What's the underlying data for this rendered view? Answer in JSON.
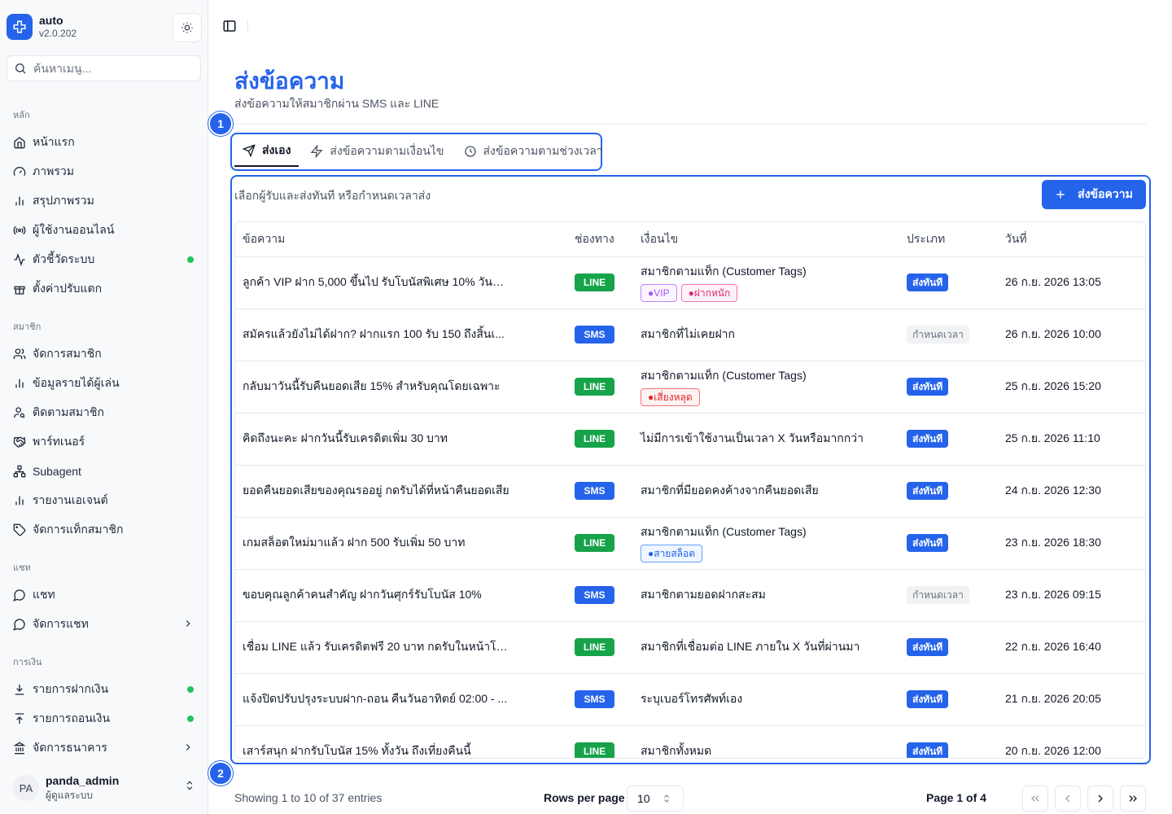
{
  "app": {
    "name": "auto",
    "version": "v2.0.202"
  },
  "search": {
    "placeholder": "ค้นหาเมนู..."
  },
  "sidebar": {
    "sections": [
      {
        "label": "หลัก",
        "items": [
          {
            "label": "หน้าแรก",
            "icon": "home-icon"
          },
          {
            "label": "ภาพรวม",
            "icon": "gauge-icon"
          },
          {
            "label": "สรุปภาพรวม",
            "icon": "bar-chart-icon"
          },
          {
            "label": "ผู้ใช้งานออนไลน์",
            "icon": "radio-icon"
          },
          {
            "label": "ตัวชี้วัดระบบ",
            "icon": "activity-icon",
            "status_dot": true
          },
          {
            "label": "ตั้งค่าปรับแตก",
            "icon": "gift-icon"
          }
        ]
      },
      {
        "label": "สมาชิก",
        "items": [
          {
            "label": "จัดการสมาชิก",
            "icon": "users-icon"
          },
          {
            "label": "ข้อมูลรายได้ผู้เล่น",
            "icon": "bar-chart-icon"
          },
          {
            "label": "ติดตามสมาชิก",
            "icon": "user-search-icon"
          },
          {
            "label": "พาร์ทเนอร์",
            "icon": "handshake-icon"
          },
          {
            "label": "Subagent",
            "icon": "network-icon"
          },
          {
            "label": "รายงานเอเจนต์",
            "icon": "bar-chart-icon"
          },
          {
            "label": "จัดการแท็กสมาชิก",
            "icon": "tag-icon"
          }
        ]
      },
      {
        "label": "แชท",
        "items": [
          {
            "label": "แชท",
            "icon": "chat-icon"
          },
          {
            "label": "จัดการแชท",
            "icon": "chat-icon",
            "chevron": true
          }
        ]
      },
      {
        "label": "การเงิน",
        "items": [
          {
            "label": "รายการฝากเงิน",
            "icon": "download-icon",
            "status_dot": true
          },
          {
            "label": "รายการถอนเงิน",
            "icon": "upload-icon",
            "status_dot": true
          },
          {
            "label": "จัดการธนาคาร",
            "icon": "bank-icon",
            "chevron": true
          }
        ]
      }
    ]
  },
  "user": {
    "initials": "PA",
    "name": "panda_admin",
    "role": "ผู้ดูแลระบบ"
  },
  "page": {
    "title": "ส่งข้อความ",
    "subtitle": "ส่งข้อความให้สมาชิกผ่าน SMS และ LINE"
  },
  "markers": [
    "1",
    "2"
  ],
  "tabs": [
    {
      "label": "ส่งเอง",
      "icon": "send-icon",
      "active": true
    },
    {
      "label": "ส่งข้อความตามเงื่อนไข",
      "icon": "zap-icon",
      "active": false
    },
    {
      "label": "ส่งข้อความตามช่วงเวลา",
      "icon": "clock-icon",
      "active": false
    }
  ],
  "card": {
    "description": "เลือกผู้รับและส่งทันที หรือกำหนดเวลาส่ง",
    "action_label": "ส่งข้อความ"
  },
  "table": {
    "columns": [
      "ข้อความ",
      "ช่องทาง",
      "เงื่อนไข",
      "ประเภท",
      "วันที่"
    ],
    "rows": [
      {
        "message": "ลูกค้า VIP ฝาก 5,000 ขึ้นไป รับโบนัสพิเศษ 10% วันนี้เ...",
        "channel": "LINE",
        "condition": "สมาชิกตามแท็ก (Customer Tags)",
        "tags": [
          {
            "label": "●VIP",
            "color": "purple"
          },
          {
            "label": "●ฝากหนัก",
            "color": "pink"
          }
        ],
        "type": "ส่งทันที",
        "date": "26 ก.ย. 2026 13:05"
      },
      {
        "message": "สมัครแล้วยังไม่ได้ฝาก? ฝากแรก 100 รับ 150 ถึงสิ้นเ...",
        "channel": "SMS",
        "condition": "สมาชิกที่ไม่เคยฝาก",
        "tags": [],
        "type": "กำหนดเวลา",
        "date": "26 ก.ย. 2026 10:00"
      },
      {
        "message": "กลับมาวันนี้รับคืนยอดเสีย 15% สำหรับคุณโดยเฉพาะ",
        "channel": "LINE",
        "condition": "สมาชิกตามแท็ก (Customer Tags)",
        "tags": [
          {
            "label": "●เสี่ยงหลุด",
            "color": "red"
          }
        ],
        "type": "ส่งทันที",
        "date": "25 ก.ย. 2026 15:20"
      },
      {
        "message": "คิดถึงนะคะ ฝากวันนี้รับเครดิตเพิ่ม 30 บาท",
        "channel": "LINE",
        "condition": "ไม่มีการเข้าใช้งานเป็นเวลา X วันหรือมากกว่า",
        "tags": [],
        "type": "ส่งทันที",
        "date": "25 ก.ย. 2026 11:10"
      },
      {
        "message": "ยอดคืนยอดเสียของคุณรออยู่ กดรับได้ที่หน้าคืนยอดเสีย",
        "channel": "SMS",
        "condition": "สมาชิกที่มียอดคงค้างจากคืนยอดเสีย",
        "tags": [],
        "type": "ส่งทันที",
        "date": "24 ก.ย. 2026 12:30"
      },
      {
        "message": "เกมสล็อตใหม่มาแล้ว ฝาก 500 รับเพิ่ม 50 บาท",
        "channel": "LINE",
        "condition": "สมาชิกตามแท็ก (Customer Tags)",
        "tags": [
          {
            "label": "●สายสล็อต",
            "color": "blue"
          }
        ],
        "type": "ส่งทันที",
        "date": "23 ก.ย. 2026 18:30"
      },
      {
        "message": "ขอบคุณลูกค้าคนสำคัญ ฝากวันศุกร์รับโบนัส 10%",
        "channel": "SMS",
        "condition": "สมาชิกตามยอดฝากสะสม",
        "tags": [],
        "type": "กำหนดเวลา",
        "date": "23 ก.ย. 2026 09:15"
      },
      {
        "message": "เชื่อม LINE แล้ว รับเครดิตฟรี 20 บาท กดรับในหน้าโปร...",
        "channel": "LINE",
        "condition": "สมาชิกที่เชื่อมต่อ LINE ภายใน X วันที่ผ่านมา",
        "tags": [],
        "type": "ส่งทันที",
        "date": "22 ก.ย. 2026 16:40"
      },
      {
        "message": "แจ้งปิดปรับปรุงระบบฝาก-ถอน คืนวันอาทิตย์ 02:00 - ...",
        "channel": "SMS",
        "condition": "ระบุเบอร์โทรศัพท์เอง",
        "tags": [],
        "type": "ส่งทันที",
        "date": "21 ก.ย. 2026 20:05"
      },
      {
        "message": "เสาร์สนุก ฝากรับโบนัส 15% ทั้งวัน ถึงเที่ยงคืนนี้",
        "channel": "LINE",
        "condition": "สมาชิกทั้งหมด",
        "tags": [],
        "type": "ส่งทันที",
        "date": "20 ก.ย. 2026 12:00"
      }
    ]
  },
  "pagination": {
    "info": "Showing 1 to 10 of 37 entries",
    "rows_per_page_label": "Rows per page",
    "rows_per_page": "10",
    "page_label": "Page 1 of 4"
  },
  "colors": {
    "accent": "#2563eb",
    "line": "#16a34a",
    "sms": "#2563eb",
    "status_dot": "#22c55e"
  }
}
